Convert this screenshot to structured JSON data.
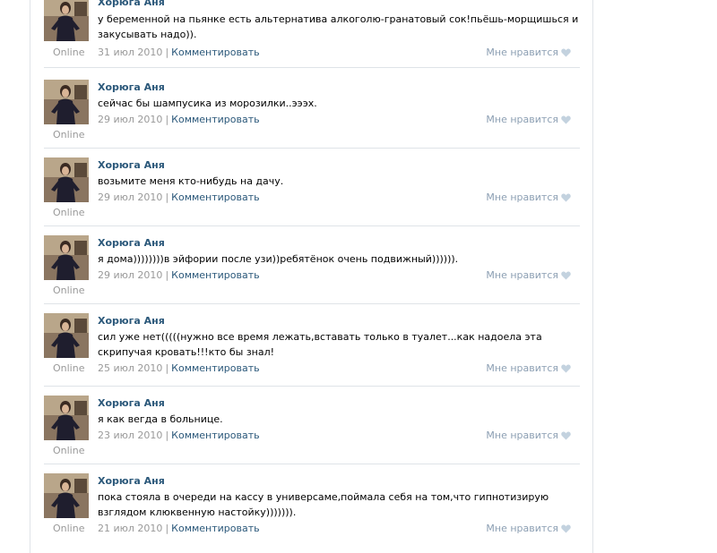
{
  "wall": {
    "posts": [
      {
        "author": "Хорюга Аня",
        "text": "у беременной на пьянке есть альтернатива алкоголю-гранатовый сок!пьёшь-морщишься и закусывать надо)).",
        "date": "31 июл 2010",
        "comment_label": "Комментировать",
        "like_label": "Мне нравится",
        "status": "Online"
      },
      {
        "author": "Хорюга Аня",
        "text": "сейчас бы шампусика из морозилки..эээх.",
        "date": "29 июл 2010",
        "comment_label": "Комментировать",
        "like_label": "Мне нравится",
        "status": "Online"
      },
      {
        "author": "Хорюга Аня",
        "text": "возьмите меня кто-нибудь на дачу.",
        "date": "29 июл 2010",
        "comment_label": "Комментировать",
        "like_label": "Мне нравится",
        "status": "Online"
      },
      {
        "author": "Хорюга Аня",
        "text": "я дома))))))))в эйфории после узи))ребятёнок очень подвижный)))))).",
        "date": "29 июл 2010",
        "comment_label": "Комментировать",
        "like_label": "Мне нравится",
        "status": "Online"
      },
      {
        "author": "Хорюга Аня",
        "text": "сил уже нет(((((нужно все время лежать,вставать только в туалет...как надоела эта скрипучая кровать!!!кто бы знал!",
        "date": "25 июл 2010",
        "comment_label": "Комментировать",
        "like_label": "Мне нравится",
        "status": "Online"
      },
      {
        "author": "Хорюга Аня",
        "text": "я как вегда в больнице.",
        "date": "23 июл 2010",
        "comment_label": "Комментировать",
        "like_label": "Мне нравится",
        "status": "Online"
      },
      {
        "author": "Хорюга Аня",
        "text": "пока стояла в очереди на кассу в универсаме,поймала себя на том,что гипнотизирую взглядом клюквенную настойку))))))).",
        "date": "21 июл 2010",
        "comment_label": "Комментировать",
        "like_label": "Мне нравится",
        "status": "Online"
      }
    ]
  },
  "colors": {
    "link": "#2b587a",
    "muted": "#999999",
    "like": "#8c9fb3",
    "divider": "#dfe3e8"
  },
  "icons": {
    "like": "heart-icon"
  }
}
